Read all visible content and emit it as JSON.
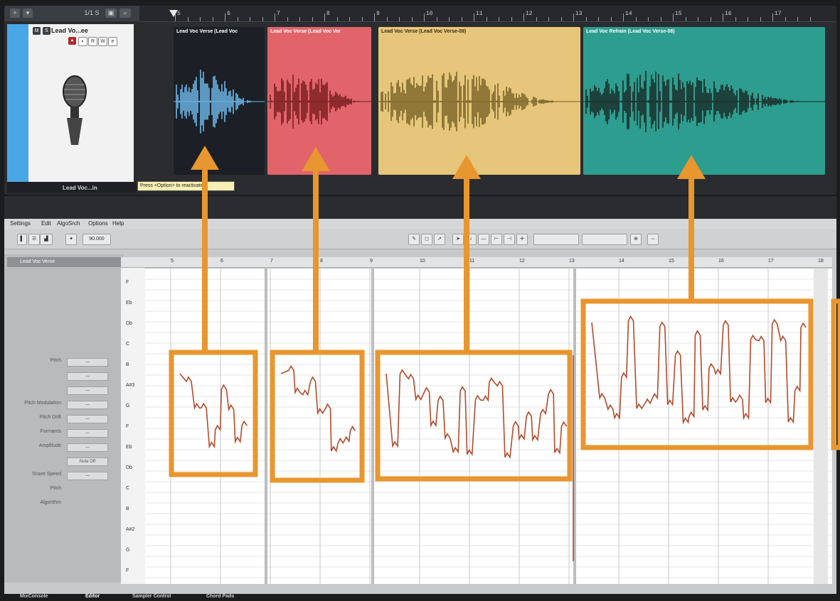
{
  "arrange": {
    "toolbar": {
      "add_label": "+",
      "view_label": "1/1 S"
    },
    "ruler_numbers": [
      "5",
      "6",
      "7",
      "8",
      "9",
      "10",
      "11",
      "12",
      "13",
      "14",
      "15",
      "16",
      "17"
    ],
    "track": {
      "name": "Lead Vo...ee",
      "mute": "M",
      "solo": "S",
      "footer_name": "Lead Voc...in"
    },
    "tooltip": "Press <Option> to reactivate",
    "clips": [
      {
        "title": "Lead Voc Verse (Lead Voc",
        "color": "#1c2026",
        "wave": "#6cb6e8"
      },
      {
        "title": "Lead Voc Verse (Lead Voc Ver",
        "color": "#e2646b",
        "wave": "#7a1e1e"
      },
      {
        "title": "Lead Voc Verse (Lead Voc Verse-09)",
        "color": "#e6c67a",
        "wave": "#7a6428"
      },
      {
        "title": "Lead Voc Refrain (Lead Voc Verse-08)",
        "color": "#2c9d8e",
        "wave": "#1a2a28"
      }
    ]
  },
  "editor": {
    "menu": [
      "Settings",
      "Edit",
      "AlgoSrch",
      "Options",
      "Help"
    ],
    "tempo": "90.000",
    "ruler_numbers": [
      "5",
      "6",
      "7",
      "8",
      "9",
      "10",
      "11",
      "12",
      "13",
      "14",
      "15",
      "16",
      "17",
      "18"
    ],
    "inspector_title": "Lead Voc Verse",
    "params": [
      {
        "label": "Pitch",
        "value": "—"
      },
      {
        "label": "",
        "value": "—"
      },
      {
        "label": "",
        "value": "—"
      },
      {
        "label": "Pitch Modulation",
        "value": "—"
      },
      {
        "label": "Pitch Drift",
        "value": "—"
      },
      {
        "label": "Formants",
        "value": "—"
      },
      {
        "label": "Amplitude",
        "value": "—"
      },
      {
        "label": "",
        "value": "Note Off"
      },
      {
        "label": "Snare Speed",
        "value": "—"
      },
      {
        "label": "Pitch",
        "value": ""
      },
      {
        "label": "Algorithm",
        "value": ""
      }
    ],
    "key_labels": [
      "F",
      "Eb",
      "Db",
      "C",
      "B",
      "A#3",
      "G",
      "F",
      "Eb",
      "Db",
      "C",
      "B",
      "A#2",
      "G",
      "F"
    ]
  },
  "bottom_tabs": [
    "MixConsole",
    "Editor",
    "Sampler Control",
    "Chord Pads"
  ],
  "accent": "#e8962f"
}
